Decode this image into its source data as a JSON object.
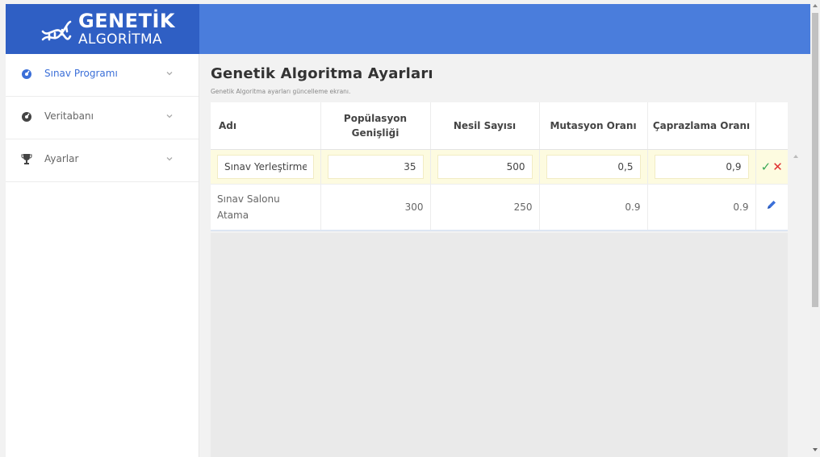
{
  "brand": {
    "title": "GENETİK",
    "subtitle": "ALGORİTMA",
    "icon": "dna-icon",
    "color": "#2f5fc4"
  },
  "header": {
    "color": "#4a7ddc"
  },
  "sidebar": {
    "items": [
      {
        "label": "Sınav Programı",
        "icon": "dashboard-icon",
        "active": true
      },
      {
        "label": "Veritabanı",
        "icon": "database-icon",
        "active": false
      },
      {
        "label": "Ayarlar",
        "icon": "trophy-icon",
        "active": false
      }
    ]
  },
  "page": {
    "title": "Genetik Algoritma Ayarları",
    "subtitle": "Genetik Algoritma ayarları güncelleme ekranı."
  },
  "grid": {
    "columns": [
      "Adı",
      "Popülasyon Genişliği",
      "Nesil Sayısı",
      "Mutasyon Oranı",
      "Çaprazlama Oranı"
    ],
    "rows": [
      {
        "name": "Sınav Yerleştirme",
        "population": "35",
        "generations": "500",
        "mutation": "0,5",
        "crossover": "0,9",
        "editing": true
      },
      {
        "name": "Sınav Salonu Atama",
        "population": "300",
        "generations": "250",
        "mutation": "0.9",
        "crossover": "0.9",
        "editing": false
      }
    ]
  }
}
